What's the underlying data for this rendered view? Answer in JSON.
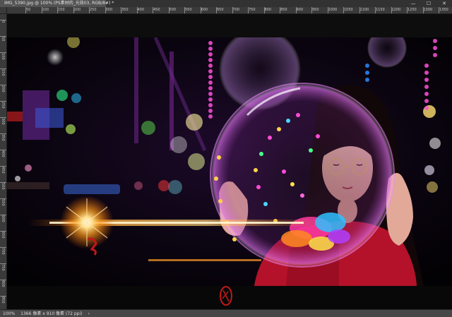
{
  "window": {
    "doc_title": "IMG_5390.jpg @ 100% (PS素材的_光效03, RGB/8#) *",
    "minimize_glyph": "—",
    "maximize_glyph": "☐",
    "close_glyph": "✕"
  },
  "ruler": {
    "horizontal_labels": [
      "50",
      "100",
      "150",
      "200",
      "250",
      "300",
      "350",
      "400",
      "450",
      "500",
      "550",
      "600",
      "650",
      "700",
      "750",
      "800",
      "850",
      "900",
      "950",
      "1000",
      "1050",
      "1100",
      "1150",
      "1200",
      "1250",
      "1300",
      "1350"
    ],
    "vertical_labels": [
      "0",
      "50",
      "100",
      "150",
      "200",
      "250",
      "300",
      "350",
      "400",
      "450",
      "500",
      "550",
      "600",
      "650",
      "700",
      "750",
      "800",
      "850"
    ]
  },
  "status": {
    "zoom": "100%",
    "doc_info": "1366 像素 x 910 像素 (72 ppi)",
    "arrow_glyph": "›"
  },
  "colors": {
    "accent": "#31a8ff",
    "flare": "#ffb347",
    "bubble_glow": "#e040fb",
    "dress_red": "#b3122a"
  },
  "icons": {
    "app": "photoshop-icon",
    "minimize": "minimize-icon",
    "maximize": "maximize-icon",
    "close": "close-icon"
  }
}
